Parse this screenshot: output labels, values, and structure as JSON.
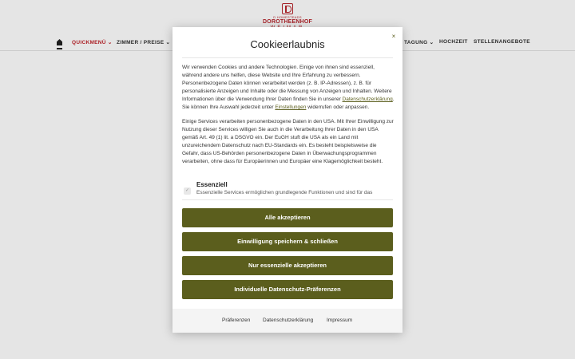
{
  "logo": {
    "tagline": "D HOMESTEADS",
    "name": "DOROTHEENHOF",
    "city": "WEIMAR"
  },
  "nav": {
    "home_icon": "home-icon",
    "items": [
      {
        "label": "QUICKMENÜ ⌄",
        "active": true
      },
      {
        "label": "ZIMMER / PREISE ⌄"
      },
      {
        "label": "TAGUNG ⌄"
      },
      {
        "label": "HOCHZEIT"
      },
      {
        "label": "STELLENANGEBOTE"
      }
    ]
  },
  "modal": {
    "title": "Cookieerlaubnis",
    "close": "×",
    "intro_part1": "Wir verwenden Cookies und andere Technologien. Einige von ihnen sind essenziell, während andere uns helfen, diese Website und Ihre Erfahrung zu verbessern. Personenbezogene Daten können verarbeitet werden (z. B. IP-Adressen), z. B. für personalisierte Anzeigen und Inhalte oder die Messung von Anzeigen und Inhalten. Weitere Informationen über die Verwendung Ihrer Daten finden Sie in unserer ",
    "intro_link1": "Datenschutzerklärung",
    "intro_part2": ". Sie können Ihre Auswahl jederzeit unter ",
    "intro_link2": "Einstellungen",
    "intro_part3": " widerrufen oder anpassen.",
    "usa_notice": "Einige Services verarbeiten personenbezogene Daten in den USA. Mit Ihrer Einwilligung zur Nutzung dieser Services willigen Sie auch in die Verarbeitung Ihrer Daten in den USA gemäß Art. 49 (1) lit. a DSGVO ein. Der EuGH stuft die USA als ein Land mit unzureichendem Datenschutz nach EU-Standards ein. Es besteht beispielsweise die Gefahr, dass US-Behörden personenbezogene Daten in Überwachungsprogrammen verarbeiten, ohne dass für Europäerinnen und Europäer eine Klagemöglichkeit besteht.",
    "essential": {
      "title": "Essenziell",
      "description": "Essenzielle Services ermöglichen grundlegende Funktionen und sind für das",
      "checked": true
    },
    "buttons": {
      "accept_all": "Alle akzeptieren",
      "save_close": "Einwilligung speichern & schließen",
      "essential_only": "Nur essenzielle akzeptieren",
      "individual": "Individuelle Datenschutz-Präferenzen"
    },
    "footer": {
      "preferences": "Präferenzen",
      "privacy": "Datenschutzerklärung",
      "imprint": "Impressum"
    }
  },
  "colors": {
    "accent": "#5b5e1d",
    "brand": "#b8262d"
  }
}
